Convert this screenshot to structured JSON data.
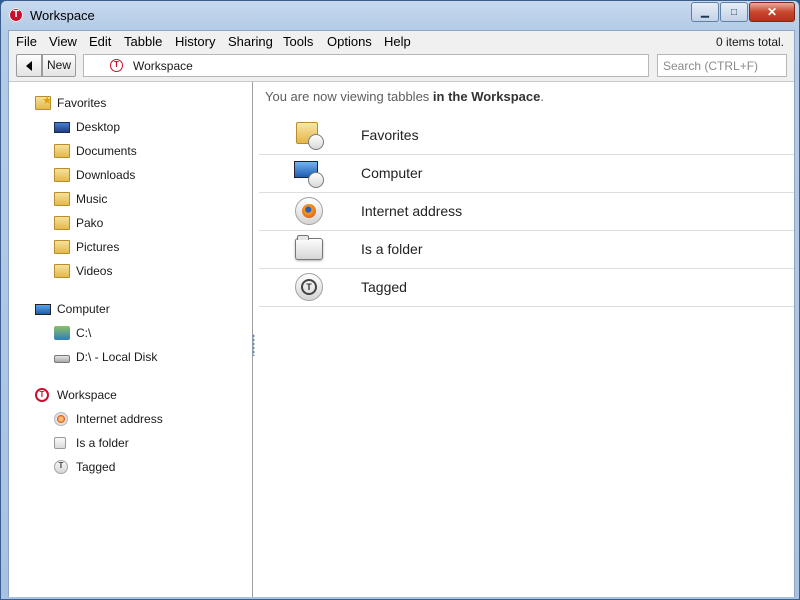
{
  "window": {
    "title": "Workspace",
    "minimize_glyph": "▁",
    "maximize_glyph": "□",
    "close_glyph": "✕"
  },
  "menubar": {
    "items": [
      "File",
      "View",
      "Edit",
      "Tabble",
      "History",
      "Sharing",
      "Tools",
      "Options",
      "Help"
    ],
    "items_total": "0 items total."
  },
  "toolbar": {
    "new_label": "New",
    "address": "Workspace",
    "search_placeholder": "Search (CTRL+F)"
  },
  "sidebar": {
    "favorites": {
      "label": "Favorites",
      "items": [
        "Desktop",
        "Documents",
        "Downloads",
        "Music",
        "Pako",
        "Pictures",
        "Videos"
      ]
    },
    "computer": {
      "label": "Computer",
      "items": [
        "C:\\",
        "D:\\ - Local Disk"
      ]
    },
    "workspace": {
      "label": "Workspace",
      "items": [
        "Internet address",
        "Is a folder",
        "Tagged"
      ]
    }
  },
  "main": {
    "intro_prefix": "You are now viewing tabbles",
    "intro_bold": "in the Workspace",
    "intro_suffix": ".",
    "rows": [
      {
        "label": "Favorites",
        "icon": "folder-star-icon"
      },
      {
        "label": "Computer",
        "icon": "computer-icon"
      },
      {
        "label": "Internet address",
        "icon": "firefox-icon"
      },
      {
        "label": "Is a folder",
        "icon": "folder-icon"
      },
      {
        "label": "Tagged",
        "icon": "tag-icon"
      }
    ]
  },
  "colors": {
    "accent": "#c8102e",
    "frame": "#a9c2e1"
  }
}
